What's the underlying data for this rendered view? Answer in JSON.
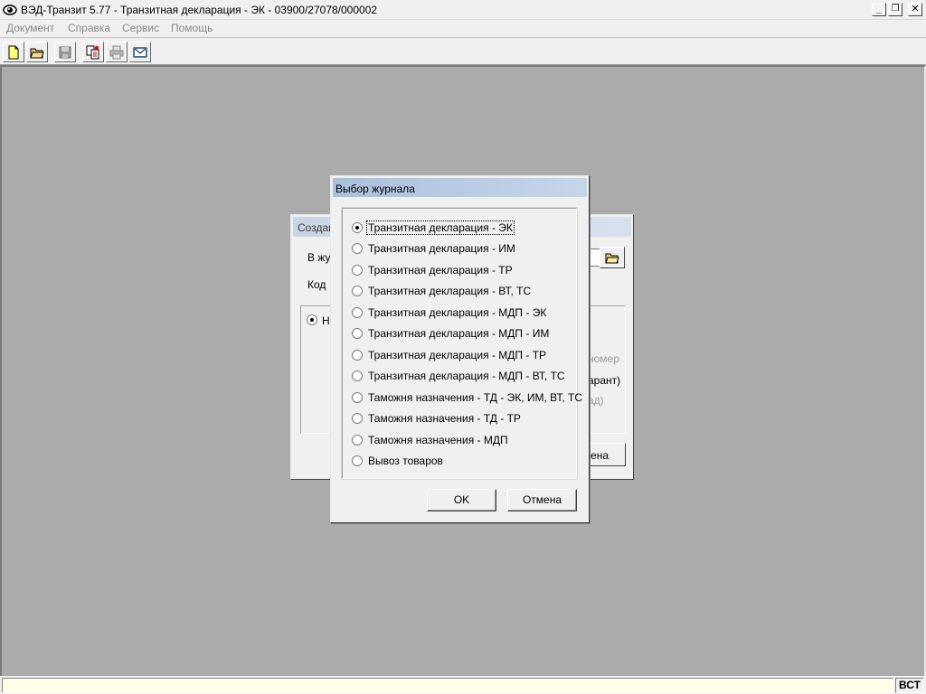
{
  "window": {
    "title": "ВЭД-Транзит 5.77  - Транзитная декларация - ЭК - 03900/27078/000002",
    "minimize": "_",
    "restore": "❐",
    "close": "✕"
  },
  "menu": [
    "Документ",
    "Справка",
    "Сервис",
    "Помощь"
  ],
  "toolbar": [
    {
      "name": "new-document-icon"
    },
    {
      "name": "open-folder-icon"
    },
    {
      "name": "save-disk-icon"
    },
    {
      "name": "copy-document-icon"
    },
    {
      "name": "print-icon"
    },
    {
      "name": "email-envelope-icon"
    }
  ],
  "background_dialog": {
    "title": "Создан",
    "label_journal": "В жу",
    "label_code": "Код",
    "radio_label": "Н",
    "right_text_1": "номер",
    "right_text_2": "арант)",
    "right_text_3": "ад)",
    "button_fragment": "ена"
  },
  "dialog": {
    "title": "Выбор журнала",
    "options": [
      "Транзитная декларация - ЭК",
      "Транзитная декларация - ИМ",
      "Транзитная декларация - ТР",
      "Транзитная декларация - ВТ, ТС",
      "Транзитная декларация - МДП - ЭК",
      "Транзитная декларация - МДП - ИМ",
      "Транзитная декларация - МДП - ТР",
      "Транзитная декларация - МДП - ВТ, ТС",
      "Таможня назначения - ТД - ЭК, ИМ, ВТ, ТС",
      "Таможня назначения - ТД - ТР",
      "Таможня назначения - МДП",
      "Вывоз товаров"
    ],
    "selected_index": 0,
    "ok_label": "OK",
    "cancel_label": "Отмена"
  },
  "statusbar": {
    "message": "",
    "ins_mode": "ВСТ"
  }
}
